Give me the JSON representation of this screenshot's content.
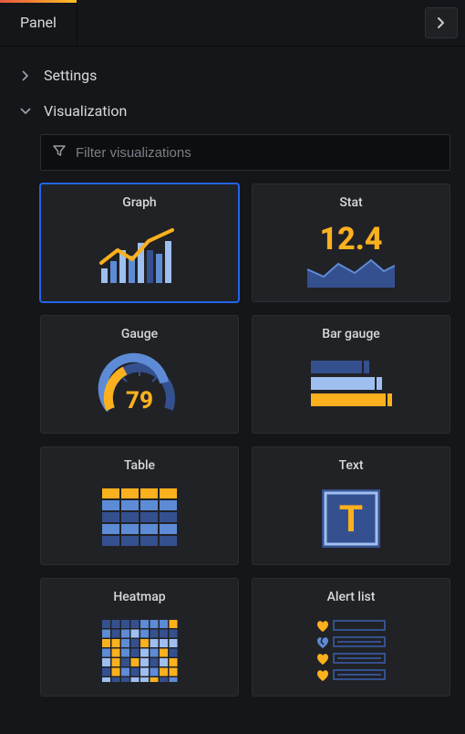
{
  "colors": {
    "blue_mid": "#5d8bd6",
    "blue_light": "#9ebff0",
    "blue_dark": "#35508f",
    "orange": "#fbb01e",
    "orange_dark": "#d6920f"
  },
  "tabs": {
    "panel_label": "Panel"
  },
  "collapse_glyph": "›",
  "sections": {
    "settings_label": "Settings",
    "visualization_label": "Visualization"
  },
  "chevrons": {
    "right": "›",
    "down": "⌄"
  },
  "filter": {
    "placeholder": "Filter visualizations"
  },
  "viz": [
    {
      "id": "graph",
      "label": "Graph",
      "selected": true
    },
    {
      "id": "stat",
      "label": "Stat",
      "selected": false,
      "stat_value": "12.4"
    },
    {
      "id": "gauge",
      "label": "Gauge",
      "selected": false,
      "gauge_value": "79"
    },
    {
      "id": "bargauge",
      "label": "Bar gauge",
      "selected": false
    },
    {
      "id": "table",
      "label": "Table",
      "selected": false
    },
    {
      "id": "text",
      "label": "Text",
      "selected": false,
      "glyph": "T"
    },
    {
      "id": "heatmap",
      "label": "Heatmap",
      "selected": false
    },
    {
      "id": "alertlist",
      "label": "Alert list",
      "selected": false
    }
  ]
}
